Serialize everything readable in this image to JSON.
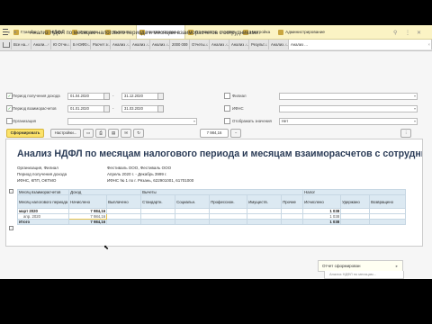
{
  "sections": {
    "items": [
      "Главное",
      "Кадры",
      "Зарплата",
      "Выплаты",
      "Налоги и взносы",
      "Отчетность, справки",
      "Настройка",
      "Администрирование"
    ]
  },
  "open_tabs": [
    "Все на...",
    "Анали...",
    "Ю Отче...",
    "Б НЭФ0...",
    "Расчет з...",
    "Анализ ...",
    "Анализ ...",
    "Анализ ...",
    "2000 000",
    "Отчеты...",
    "Анализ ...",
    "Анализ ...",
    "Результ...",
    "Анализ ...",
    "Анализ ..."
  ],
  "report_form": {
    "title": "Анализ НДФЛ по месяцам налогового периода и месяцам взаиморасчетов с сотрудниками",
    "filters": {
      "income_period_label": "Период получения дохода",
      "income_from": "01.04.2020",
      "income_to": "31.12.2020",
      "settlement_period_label": "Период взаиморасчетов",
      "settlement_from": "01.01.2020",
      "settlement_to": "31.03.2020",
      "org_label": "Организация",
      "branch_label": "Филиал",
      "ifns_label": "ИФНС",
      "show_values_label": "Отображать значения",
      "show_values_value": "Нет",
      "dash": "-"
    },
    "toolbar": {
      "generate": "Сформировать",
      "settings": "Настройки...",
      "sum_value": "7 984,16"
    }
  },
  "report": {
    "title": "Анализ НДФЛ по месяцам налогового периода и месяцам взаиморасчетов с сотрудниками",
    "meta": [
      {
        "label": "Организация, Филиал",
        "value": "Фестиваль ООО, Фестиваль ООО"
      },
      {
        "label": "Период получения дохода",
        "value": "Апрель 2020 г. - Декабрь 3999 г."
      },
      {
        "label": "ИФНС, КПП, ОКТМО",
        "value": "ИФНС № 1 по г. Рязань, 622901001, 61701000"
      }
    ],
    "group_headers": {
      "income": "Доход",
      "deductions": "Вычеты",
      "tax": "Налог"
    },
    "col1_head_a": "Месяц взаиморасчетов",
    "col1_head_b": "Месяц налогового периода",
    "columns": [
      "Начислено",
      "Выплачено",
      "Стандартн.",
      "Социальн.",
      "Профессион.",
      "Имуществ.",
      "Прочие",
      "Исчислено",
      "Удержано",
      "Возвращено"
    ],
    "rows": [
      {
        "label": "март 2020",
        "accrued": "7 984,16",
        "computed": "1 038"
      },
      {
        "label": "апр. 2020",
        "accrued": "7 984,16",
        "computed": "1 038"
      },
      {
        "label": "Итого",
        "accrued": "7 984,16",
        "computed": "1 038"
      }
    ]
  },
  "popup": {
    "label": "Отчет сформирован",
    "sub": "Анализ НДФЛ по месяцам..."
  }
}
